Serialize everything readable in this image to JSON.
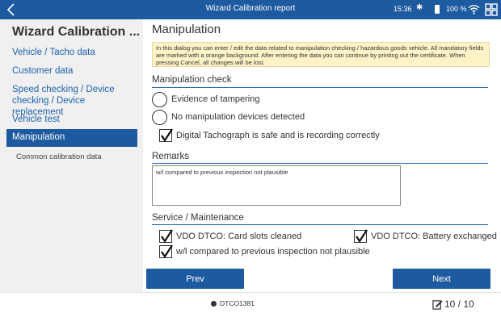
{
  "topbar": {
    "title": "Wizard Calibration report",
    "time": "15:36",
    "battery": "100 %",
    "icons": [
      "back-chevron-icon",
      "bluetooth-icon",
      "battery-icon",
      "wifi-icon",
      "apps-grid-icon"
    ]
  },
  "sidebar": {
    "title": "Wizard Calibration ...",
    "items": [
      {
        "label": "Vehicle / Tacho data"
      },
      {
        "label": "Customer data"
      },
      {
        "label": "Speed checking / Device checking / Device replacement"
      },
      {
        "label": "Vehicle test"
      },
      {
        "label": "Manipulation",
        "active": true
      }
    ],
    "subitem": "Common calibration data"
  },
  "main": {
    "title": "Manipulation",
    "info": "In this dialog you can enter / edit the data related to manipulation checking / hazardous goods vehicle. All mandatory fields are marked with a orange background. After entering the data you can continue by printing out the certificate. When pressing Cancel, all changes will be lost.",
    "manipulation_check": {
      "title": "Manipulation check",
      "options": [
        {
          "label": "Evidence of tampering",
          "type": "radio",
          "checked": false
        },
        {
          "label": "No manipulation devices detected",
          "type": "radio",
          "checked": false
        },
        {
          "label": "Digital Tachograph is safe and is recording correctly",
          "type": "checkbox",
          "checked": true
        }
      ]
    },
    "remarks": {
      "title": "Remarks",
      "value": "w/l compared to previous inspection not plausible"
    },
    "service": {
      "title": "Service / Maintenance",
      "items": [
        {
          "label": "VDO DTCO: Card slots cleaned",
          "checked": true
        },
        {
          "label": "VDO DTCO: Battery exchanged",
          "checked": true
        },
        {
          "label": "w/l compared to previous inspection not plausible",
          "checked": true
        }
      ]
    },
    "buttons": {
      "prev": "Prev",
      "next": "Next"
    }
  },
  "statusbar": {
    "device": "DTCO1381",
    "page": "10 / 10"
  },
  "colors": {
    "accent": "#1e5aa0",
    "info_background": "#fef3c7",
    "sidebar_background": "#f0f0f0",
    "link": "#1e62ad"
  }
}
